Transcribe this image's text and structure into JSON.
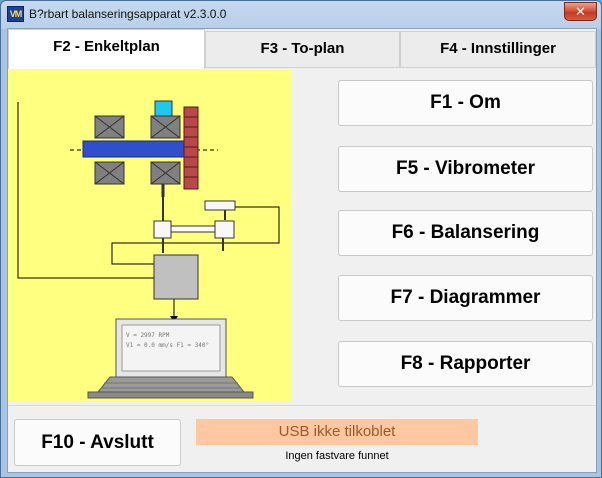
{
  "window": {
    "title": "B?rbart balanseringsapparat v2.3.0.0",
    "icon_text": "VM",
    "close_glyph": "✕"
  },
  "tabs": [
    {
      "label": "F2 - Enkeltplan",
      "active": true
    },
    {
      "label": "F3 - To-plan",
      "active": false
    },
    {
      "label": "F4 - Innstillinger",
      "active": false
    }
  ],
  "buttons": {
    "about": "F1 - Om",
    "vibrometer": "F5 - Vibrometer",
    "balancing": "F6 - Balansering",
    "charts": "F7 - Diagrammer",
    "reports": "F8 - Rapporter",
    "exit": "F10 - Avslutt"
  },
  "diagram": {
    "screen_line1": "V = 2997 RPM",
    "screen_line2": "V1 = 0.0 mm/s  F1 = 340°"
  },
  "status": {
    "usb": "USB ikke tilkoblet",
    "firmware": "Ingen fastvare funnet"
  },
  "colors": {
    "diagram_bg": "#ffff80",
    "shaft": "#2f4fcc",
    "sensor": "#1ec8f0",
    "pulley": "#b8484a",
    "usb_bg": "#ffc8a0"
  }
}
